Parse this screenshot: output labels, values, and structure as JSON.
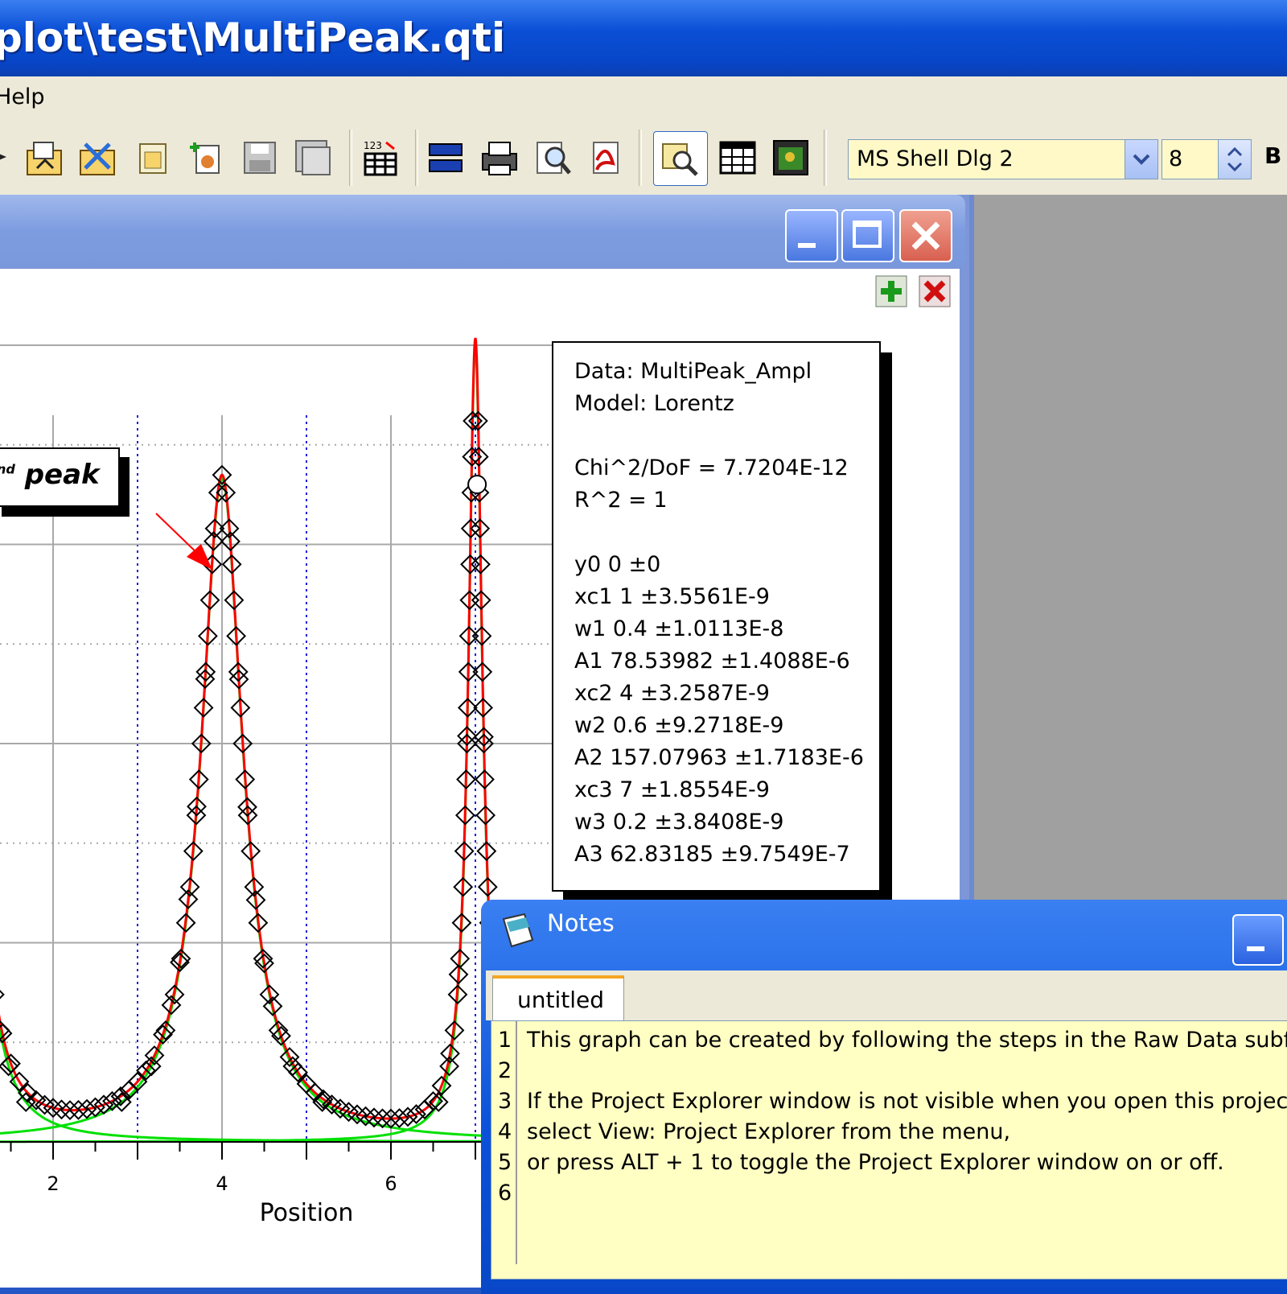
{
  "window_title": "plot\\test\\MultiPeak.qti",
  "menu": {
    "help": "Help"
  },
  "toolbar": {
    "font_name": "MS Shell Dlg 2",
    "font_size": "8",
    "bold_label": "B"
  },
  "graph": {
    "peak_label": "peak",
    "peak_label_sup": "nd",
    "x_axis_title": "Position",
    "x_ticks": [
      "2",
      "4",
      "6"
    ],
    "fit_results": {
      "lines": [
        "Data: MultiPeak_Ampl",
        "Model: Lorentz",
        "",
        "Chi^2/DoF = 7.7204E-12",
        "R^2 =  1",
        "",
        "y0 0 ±0",
        "xc1 1 ±3.5561E-9",
        "w1 0.4 ±1.0113E-8",
        "A1 78.53982 ±1.4088E-6",
        "xc2 4 ±3.2587E-9",
        "w2 0.6 ±9.2718E-9",
        "A2 157.07963 ±1.7183E-6",
        "xc3 7 ±1.8554E-9",
        "w3 0.2 ±3.8408E-9",
        "A3 62.83185 ±9.7549E-7"
      ]
    }
  },
  "chart_data": {
    "type": "scatter",
    "title": "",
    "xlabel": "Position",
    "ylabel": "",
    "xlim": [
      1.4,
      7.8
    ],
    "ylim": [
      0,
      235
    ],
    "x_ticks": [
      2,
      4,
      6
    ],
    "model": {
      "name": "Lorentz",
      "y0": 0,
      "peaks": [
        {
          "xc": 1,
          "w": 0.4,
          "A": 78.53982
        },
        {
          "xc": 4,
          "w": 0.6,
          "A": 157.07963
        },
        {
          "xc": 7,
          "w": 0.2,
          "A": 62.83185
        }
      ]
    },
    "series": [
      {
        "kind": "points",
        "color": "#000000",
        "marker": "diamond"
      },
      {
        "kind": "fit",
        "color": "#ff0000"
      },
      {
        "kind": "components",
        "color": "#00e000"
      }
    ],
    "grid": true
  },
  "notes": {
    "title": "Notes",
    "tab": "untitled",
    "line_numbers": [
      "1",
      "2",
      "3",
      "4",
      "5",
      "6"
    ],
    "lines": [
      "This graph can be created by following the steps in the Raw Data subfold",
      "",
      "If the Project Explorer window is not visible when you open this project,",
      "select View: Project Explorer from the menu,",
      "or press ALT + 1 to toggle the Project Explorer window on or off.",
      ""
    ]
  },
  "colors": {
    "title_blue": "#0a4fd6",
    "note_bg": "#ffffc4",
    "fit_red": "#ff0000",
    "component_green": "#00e000"
  }
}
